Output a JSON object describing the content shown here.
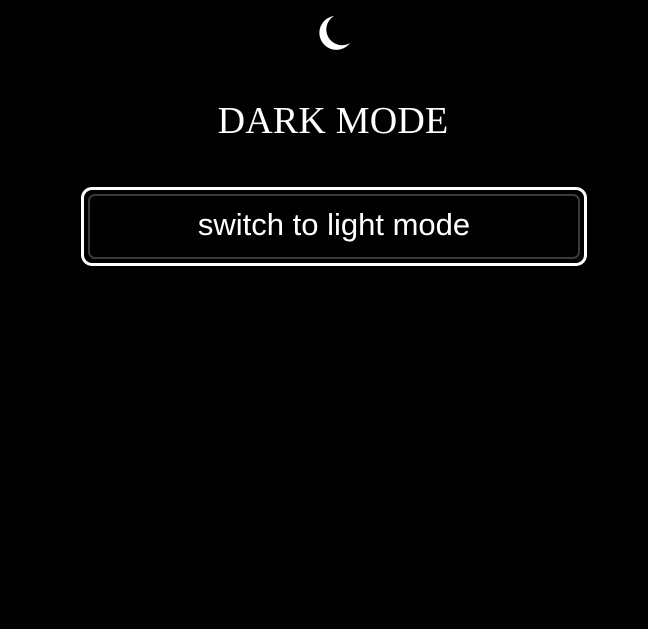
{
  "icon": {
    "name": "moon-icon",
    "color": "#ffffff"
  },
  "title": "DARK MODE",
  "toggle_button": {
    "label": "switch to light mode"
  },
  "colors": {
    "background": "#000000",
    "text": "#ffffff",
    "button_border": "#ffffff",
    "button_inner_border": "#3a3a3a"
  }
}
